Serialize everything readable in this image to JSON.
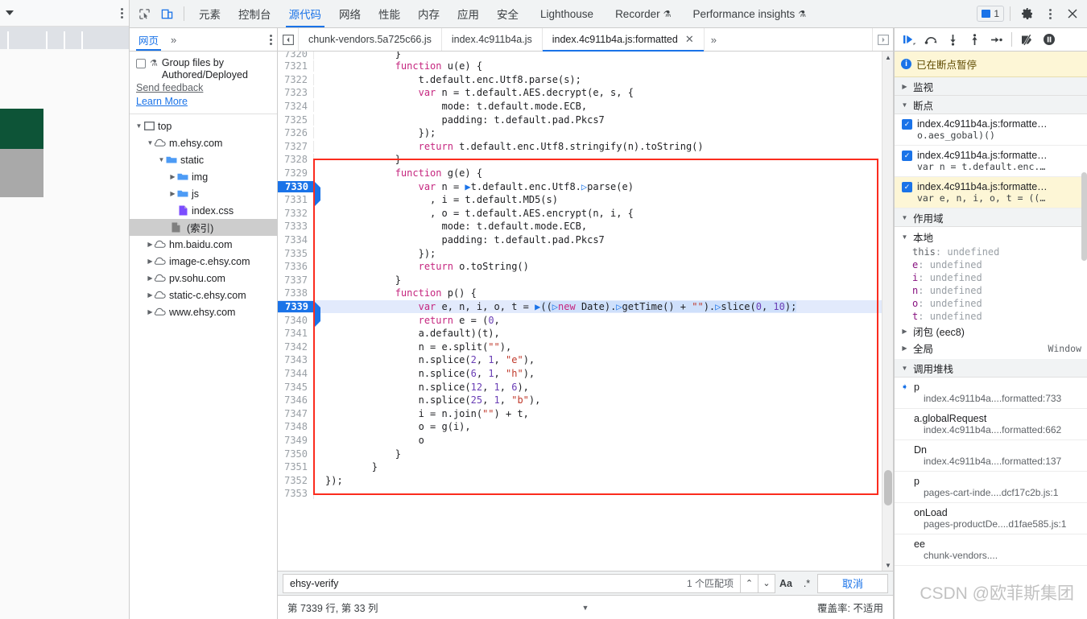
{
  "page": {
    "toolbar": {
      "caret_icon": "caret-down-icon",
      "menu_icon": "kebab-menu-icon"
    }
  },
  "devtools": {
    "toolbar": {
      "inspect_icon": "inspect-element-icon",
      "device_icon": "device-toolbar-icon",
      "tabs": [
        {
          "label": "元素",
          "active": false
        },
        {
          "label": "控制台",
          "active": false
        },
        {
          "label": "源代码",
          "active": true
        },
        {
          "label": "网络",
          "active": false
        },
        {
          "label": "性能",
          "active": false
        },
        {
          "label": "内存",
          "active": false
        },
        {
          "label": "应用",
          "active": false
        },
        {
          "label": "安全",
          "active": false
        },
        {
          "label": "Lighthouse",
          "active": false
        },
        {
          "label": "Recorder",
          "active": false,
          "flask": "⚗"
        },
        {
          "label": "Performance insights",
          "active": false,
          "flask": "⚗"
        }
      ],
      "message_count": "1",
      "settings_icon": "gear-icon",
      "more_icon": "kebab-menu-icon",
      "close_icon": "close-icon"
    },
    "navigator": {
      "tab_label": "网页",
      "more_label": "»",
      "menu_icon": "kebab-menu-icon",
      "group_checkbox_label": "Group files by Authored/Deployed",
      "flask_icon": "flask-icon",
      "send_feedback": "Send feedback",
      "learn_more": "Learn More",
      "tree": [
        {
          "label": "top",
          "icon": "frame-icon",
          "depth": 0,
          "expanded": true,
          "selected": false
        },
        {
          "label": "m.ehsy.com",
          "icon": "cloud-icon",
          "depth": 1,
          "expanded": true,
          "selected": false
        },
        {
          "label": "static",
          "icon": "folder-icon",
          "depth": 2,
          "expanded": true,
          "selected": false
        },
        {
          "label": "img",
          "icon": "folder-icon",
          "depth": 3,
          "expanded": false,
          "selected": false
        },
        {
          "label": "js",
          "icon": "folder-icon",
          "depth": 3,
          "expanded": false,
          "selected": false
        },
        {
          "label": "index.css",
          "icon": "css-file-icon",
          "depth": 3,
          "expanded": null,
          "selected": false
        },
        {
          "label": "(索引)",
          "icon": "doc-file-icon",
          "depth": 2,
          "expanded": null,
          "selected": true
        },
        {
          "label": "hm.baidu.com",
          "icon": "cloud-icon",
          "depth": 1,
          "expanded": false,
          "selected": false
        },
        {
          "label": "image-c.ehsy.com",
          "icon": "cloud-icon",
          "depth": 1,
          "expanded": false,
          "selected": false
        },
        {
          "label": "pv.sohu.com",
          "icon": "cloud-icon",
          "depth": 1,
          "expanded": false,
          "selected": false
        },
        {
          "label": "static-c.ehsy.com",
          "icon": "cloud-icon",
          "depth": 1,
          "expanded": false,
          "selected": false
        },
        {
          "label": "www.ehsy.com",
          "icon": "cloud-icon",
          "depth": 1,
          "expanded": false,
          "selected": false
        }
      ]
    },
    "editor": {
      "panel_toggle_icon": "show-navigator-icon",
      "panel_toggle_right_icon": "show-debugger-icon",
      "tabs": [
        {
          "label": "chunk-vendors.5a725c66.js",
          "active": false,
          "closable": false
        },
        {
          "label": "index.4c911b4a.js",
          "active": false,
          "closable": false
        },
        {
          "label": "index.4c911b4a.js:formatted",
          "active": true,
          "closable": true,
          "close_label": "✕"
        }
      ],
      "more_label": "»",
      "first_line_number": 7320,
      "breakpoint_lines": [
        7330
      ],
      "current_line": 7339,
      "lines": [
        {
          "n": 7320,
          "text": "            }"
        },
        {
          "n": 7321,
          "text": "            function u(e) {"
        },
        {
          "n": 7322,
          "text": "                t.default.enc.Utf8.parse(s);"
        },
        {
          "n": 7323,
          "text": "                var n = t.default.AES.decrypt(e, s, {"
        },
        {
          "n": 7324,
          "text": "                    mode: t.default.mode.ECB,"
        },
        {
          "n": 7325,
          "text": "                    padding: t.default.pad.Pkcs7"
        },
        {
          "n": 7326,
          "text": "                });"
        },
        {
          "n": 7327,
          "text": "                return t.default.enc.Utf8.stringify(n).toString()"
        },
        {
          "n": 7328,
          "text": "            }"
        },
        {
          "n": 7329,
          "text": "            function g(e) {"
        },
        {
          "n": 7330,
          "text": "                var n = t.default.enc.Utf8.parse(e)"
        },
        {
          "n": 7331,
          "text": "                  , i = t.default.MD5(s)"
        },
        {
          "n": 7332,
          "text": "                  , o = t.default.AES.encrypt(n, i, {"
        },
        {
          "n": 7333,
          "text": "                    mode: t.default.mode.ECB,"
        },
        {
          "n": 7334,
          "text": "                    padding: t.default.pad.Pkcs7"
        },
        {
          "n": 7335,
          "text": "                });"
        },
        {
          "n": 7336,
          "text": "                return o.toString()"
        },
        {
          "n": 7337,
          "text": "            }"
        },
        {
          "n": 7338,
          "text": "            function p() {"
        },
        {
          "n": 7339,
          "text": "                var e, n, i, o, t = ((new Date).getTime() + \"\").slice(0, 10);"
        },
        {
          "n": 7340,
          "text": "                return e = (0,"
        },
        {
          "n": 7341,
          "text": "                a.default)(t),"
        },
        {
          "n": 7342,
          "text": "                n = e.split(\"\"),"
        },
        {
          "n": 7343,
          "text": "                n.splice(2, 1, \"e\"),"
        },
        {
          "n": 7344,
          "text": "                n.splice(6, 1, \"h\"),"
        },
        {
          "n": 7345,
          "text": "                n.splice(12, 1, 6),"
        },
        {
          "n": 7346,
          "text": "                n.splice(25, 1, \"b\"),"
        },
        {
          "n": 7347,
          "text": "                i = n.join(\"\") + t,"
        },
        {
          "n": 7348,
          "text": "                o = g(i),"
        },
        {
          "n": 7349,
          "text": "                o"
        },
        {
          "n": 7350,
          "text": "            }"
        },
        {
          "n": 7351,
          "text": "        }"
        },
        {
          "n": 7352,
          "text": "});"
        },
        {
          "n": 7353,
          "text": ""
        }
      ],
      "annotation_box_color": "#fb2c1e"
    },
    "search": {
      "value": "ehsy-verify",
      "match_count": "1 个匹配项",
      "prev_label": "⌃",
      "next_label": "⌄",
      "match_case_label": "Aa",
      "regex_label": ".*",
      "cancel_label": "取消"
    },
    "status": {
      "cursor": "第 7339 行, 第 33 列",
      "coverage": "覆盖率: 不适用"
    },
    "debugger": {
      "toolbar_icons": [
        "resume-script-icon",
        "step-over-icon",
        "step-into-icon",
        "step-out-icon",
        "step-icon",
        "deactivate-breakpoints-icon",
        "pause-on-exceptions-icon"
      ],
      "paused_banner": "已在断点暂停",
      "watch_label": "监视",
      "breakpoints_label": "断点",
      "breakpoints": [
        {
          "file": "index.4c911b4a.js:formatte…",
          "code": "o.aes_gobal)()",
          "checked": true,
          "highlighted": false
        },
        {
          "file": "index.4c911b4a.js:formatte…",
          "code": "var n = t.default.enc.…",
          "checked": true,
          "highlighted": false
        },
        {
          "file": "index.4c911b4a.js:formatte…",
          "code": "var e, n, i, o, t = ((…",
          "checked": true,
          "highlighted": true
        }
      ],
      "scope_label": "作用域",
      "local_label": "本地",
      "locals": [
        {
          "name": "this",
          "value": "undefined"
        },
        {
          "name": "e",
          "value": "undefined"
        },
        {
          "name": "i",
          "value": "undefined"
        },
        {
          "name": "n",
          "value": "undefined"
        },
        {
          "name": "o",
          "value": "undefined"
        },
        {
          "name": "t",
          "value": "undefined"
        }
      ],
      "closure_label": "闭包  (eec8)",
      "global_label": "全局",
      "global_value": "Window",
      "callstack_label": "调用堆栈",
      "callstack": [
        {
          "fn": "p",
          "loc": "index.4c911b4a....formatted:733",
          "current": true
        },
        {
          "fn": "a.globalRequest",
          "loc": "index.4c911b4a....formatted:662",
          "current": false
        },
        {
          "fn": "Dn",
          "loc": "index.4c911b4a....formatted:137",
          "current": false
        },
        {
          "fn": "p",
          "loc": "pages-cart-inde....dcf17c2b.js:1",
          "current": false
        },
        {
          "fn": "onLoad",
          "loc": "pages-productDe....d1fae585.js:1",
          "current": false
        },
        {
          "fn": "ee",
          "loc": "chunk-vendors....",
          "current": false
        }
      ]
    }
  },
  "watermark": "CSDN @欧菲斯集团"
}
